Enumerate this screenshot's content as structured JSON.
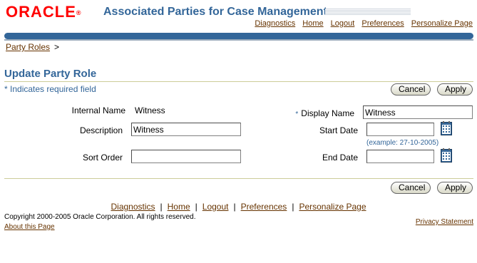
{
  "header": {
    "logo_text": "ORACLE",
    "app_title": "Associated Parties for Case Management",
    "global_links": [
      "Diagnostics",
      "Home",
      "Logout",
      "Preferences",
      "Personalize Page"
    ]
  },
  "breadcrumb": {
    "items": [
      "Party Roles"
    ],
    "separator": ">"
  },
  "page": {
    "title": "Update Party Role",
    "required_note": "Indicates required field",
    "required_star": "*"
  },
  "buttons": {
    "cancel": "Cancel",
    "apply": "Apply"
  },
  "form": {
    "internal_name_label": "Internal Name",
    "internal_name_value": "Witness",
    "description_label": "Description",
    "description_value": "Witness",
    "sort_order_label": "Sort Order",
    "sort_order_value": "",
    "display_name_label": "Display Name",
    "display_name_value": "Witness",
    "start_date_label": "Start Date",
    "start_date_value": "",
    "date_example": "(example: 27-10-2005)",
    "end_date_label": "End Date",
    "end_date_value": ""
  },
  "footer": {
    "links": [
      "Diagnostics",
      "Home",
      "Logout",
      "Preferences",
      "Personalize Page"
    ],
    "copyright": "Copyright 2000-2005 Oracle Corporation. All rights reserved.",
    "about": "About this Page",
    "privacy": "Privacy Statement"
  },
  "colors": {
    "brand_red": "#ff0000",
    "title_blue": "#336699",
    "link_brown": "#663300"
  },
  "icons": {
    "calendar": "calendar-icon"
  }
}
